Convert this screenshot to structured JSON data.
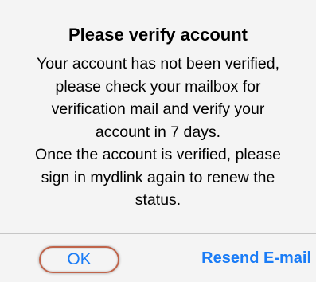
{
  "dialog": {
    "title": "Please verify account",
    "message_lines": [
      "Your account has not been verified,",
      "please check your mailbox for",
      "verification mail and verify your",
      "account in 7 days.",
      "Once the account is verified, please",
      "sign in mydlink again to renew the",
      "status."
    ],
    "buttons": {
      "ok": "OK",
      "resend": "Resend E-mail"
    }
  },
  "colors": {
    "background": "#f4f4f4",
    "button_text": "#1a7cf6",
    "divider": "#c6c6c6",
    "highlight_ring": "#c0644a"
  }
}
